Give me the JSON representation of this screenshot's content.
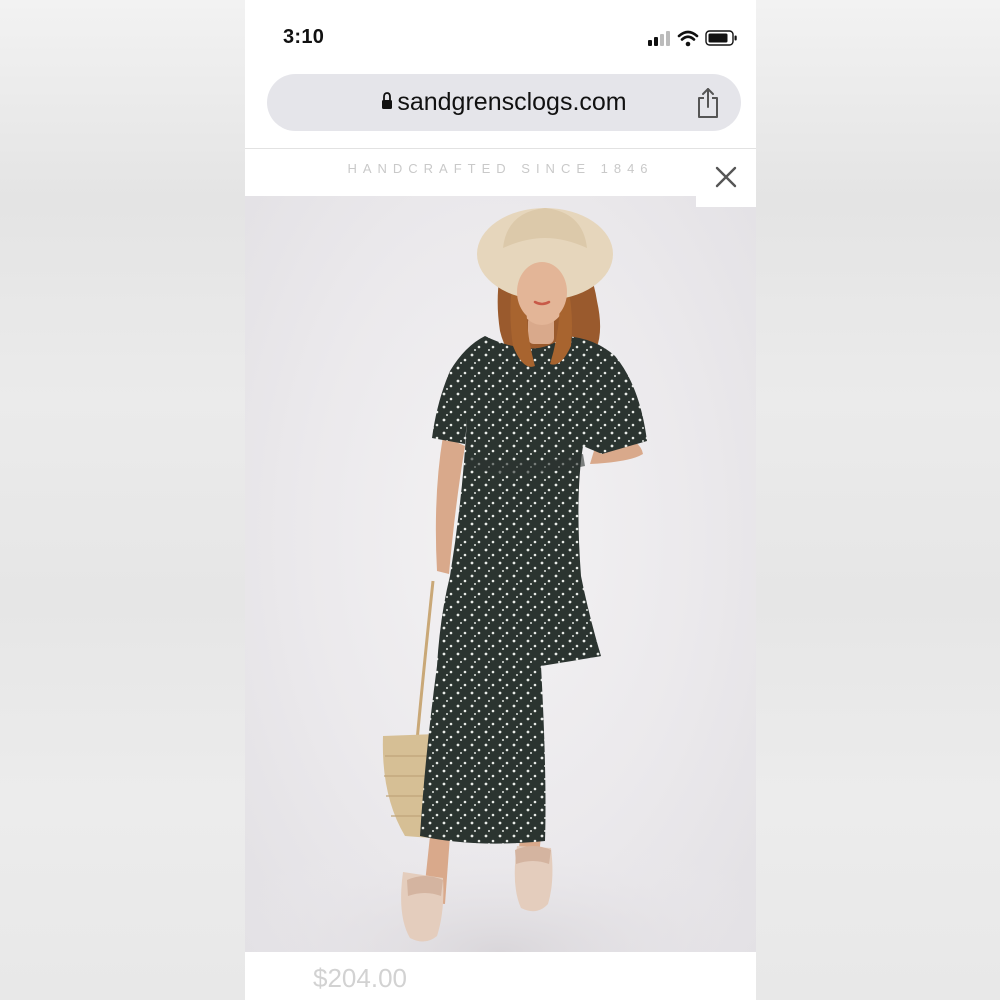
{
  "status_bar": {
    "time": "3:10",
    "icons": [
      "signal-icon",
      "wifi-icon",
      "battery-icon"
    ]
  },
  "browser": {
    "url": "sandgrensclogs.com",
    "lock_icon": "lock-icon",
    "share_icon": "share-icon"
  },
  "site": {
    "tagline": "HANDCRAFTED SINCE 1846",
    "close_icon": "close-icon"
  },
  "product": {
    "image_icon": "product-photo",
    "price": "$204.00"
  },
  "colors": {
    "url_bar_bg": "#e5e5ea",
    "tagline": "#c9c9c9",
    "price": "#d2d2d2",
    "dress": "#2b3430",
    "hat": "#e6d6bc"
  }
}
